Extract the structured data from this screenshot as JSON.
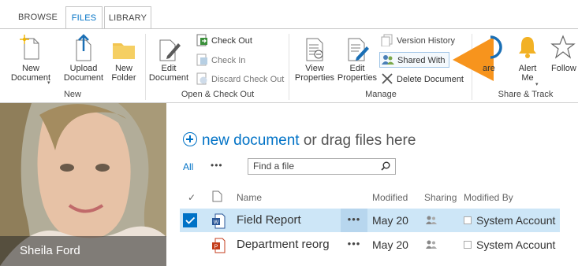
{
  "tabs": [
    {
      "label": "BROWSE"
    },
    {
      "label": "FILES"
    },
    {
      "label": "LIBRARY"
    }
  ],
  "ribbon": {
    "new_group": {
      "label": "New",
      "new_document": "New\nDocument",
      "upload_document": "Upload\nDocument",
      "new_folder": "New\nFolder"
    },
    "open_group": {
      "label": "Open & Check Out",
      "edit_document": "Edit\nDocument",
      "check_out": "Check Out",
      "check_in": "Check In",
      "discard_check_out": "Discard Check Out"
    },
    "manage_group": {
      "label": "Manage",
      "view_properties": "View\nProperties",
      "edit_properties": "Edit\nProperties",
      "version_history": "Version History",
      "shared_with": "Shared With",
      "delete_document": "Delete Document"
    },
    "share_group": {
      "label": "Share & Track",
      "share": "are",
      "alert_me": "Alert\nMe",
      "follow": "Follow"
    }
  },
  "profile": {
    "caption": "Sheila Ford"
  },
  "library": {
    "new_document_link": "new document",
    "new_document_rest": " or drag files here",
    "view_all": "All",
    "view_more": "•••",
    "search_placeholder": "Find a file",
    "columns": {
      "check": "✓",
      "name": "Name",
      "modified": "Modified",
      "sharing": "Sharing",
      "modified_by": "Modified By"
    },
    "rows": [
      {
        "name": "Field Report",
        "modified": "May 20",
        "modified_by": "System Account",
        "dots": "•••"
      },
      {
        "name": "Department reorg",
        "modified": "May 20",
        "modified_by": "System Account",
        "dots": "•••"
      }
    ]
  },
  "colors": {
    "accent": "#0072c6",
    "callout_arrow": "#f7941d",
    "selected_row": "#cde6f7"
  }
}
